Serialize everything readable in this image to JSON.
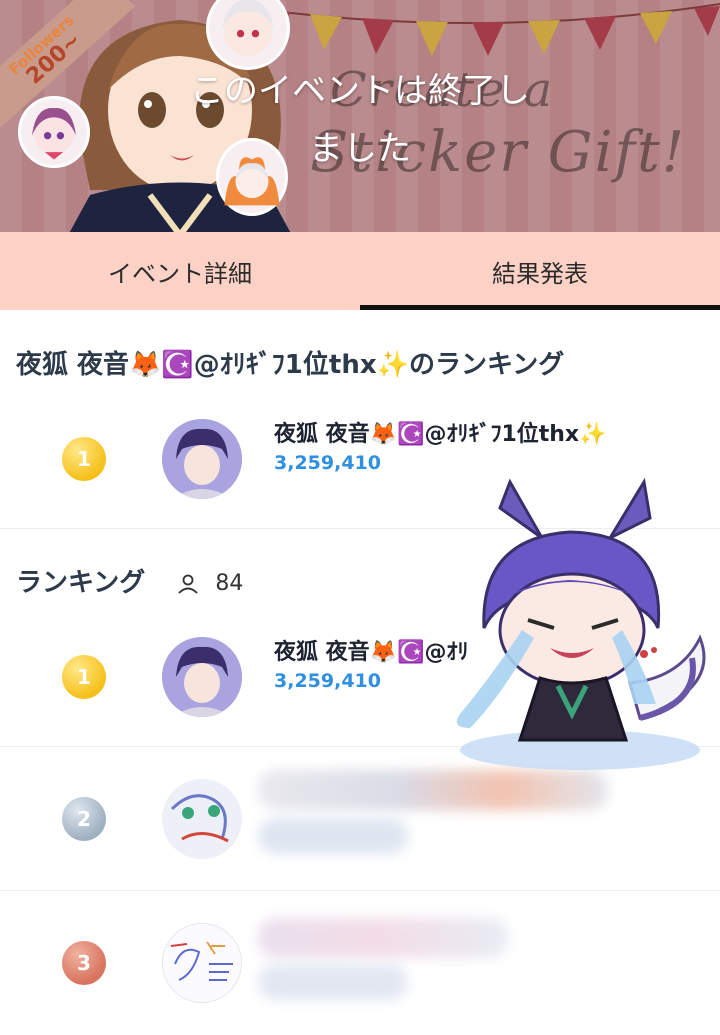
{
  "banner": {
    "followers_label": "Followers",
    "followers_count": "200~",
    "ended_line1": "このイベントは終了し",
    "ended_line2": "ました",
    "gift_line1": "Create a",
    "gift_line2": "Sticker Gift!"
  },
  "tabs": [
    {
      "label": "イベント詳細",
      "active": false
    },
    {
      "label": "結果発表",
      "active": true
    }
  ],
  "host_ranking": {
    "title": "夜狐 夜音🦊☪️@ｵﾘｷﾞﾌ1位thx✨のランキング",
    "entry": {
      "rank": "1",
      "name": "夜狐 夜音🦊☪️@ｵﾘｷﾞﾌ1位thx✨",
      "score": "3,259,410"
    }
  },
  "ranking": {
    "title": "ランキング",
    "participant_icon": "person-icon",
    "count": "84",
    "entries": [
      {
        "rank": "1",
        "name": "夜狐 夜音🦊☪️@ｵﾘ",
        "score": "3,259,410",
        "medal": "gold"
      },
      {
        "rank": "2",
        "name": "",
        "score": "",
        "medal": "silver"
      },
      {
        "rank": "3",
        "name": "",
        "score": "",
        "medal": "bronze"
      }
    ]
  },
  "colors": {
    "tab_bar": "#fbd2c5",
    "score": "#2f8fe0",
    "gold": "#f5c01a",
    "silver": "#9fb0c0",
    "bronze": "#d8735e"
  }
}
